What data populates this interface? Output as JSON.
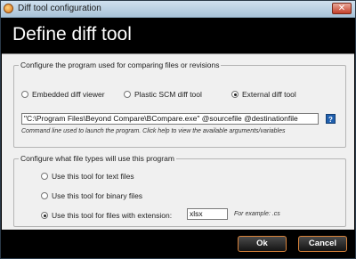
{
  "window": {
    "title": "Diff tool configuration",
    "close_glyph": "✕"
  },
  "header": {
    "title": "Define diff tool"
  },
  "program_group": {
    "legend": "Configure the program used for comparing files or revisions",
    "options": [
      {
        "label": "Embedded diff viewer",
        "selected": false
      },
      {
        "label": "Plastic SCM diff tool",
        "selected": false
      },
      {
        "label": "External diff tool",
        "selected": true
      }
    ],
    "command_value": "\"C:\\Program Files\\Beyond Compare\\BCompare.exe\" @sourcefile @destinationfile",
    "help_glyph": "?",
    "hint": "Command line used to launch the program. Click help to view the available arguments/variables"
  },
  "filetypes_group": {
    "legend": "Configure what file types will use this program",
    "options": [
      {
        "label": "Use this tool for text files",
        "selected": false
      },
      {
        "label": "Use this tool for binary files",
        "selected": false
      },
      {
        "label": "Use this tool for files with extension:",
        "selected": true
      }
    ],
    "extension_value": "xlsx",
    "example_text": "For example: .cs"
  },
  "buttons": {
    "ok": "Ok",
    "cancel": "Cancel"
  },
  "colors": {
    "header_bg": "#000000",
    "button_border": "#d9833a",
    "help_icon": "#1f5fae"
  },
  "icons": {
    "app": "diff-app-icon",
    "close": "close-icon",
    "help": "help-icon"
  }
}
